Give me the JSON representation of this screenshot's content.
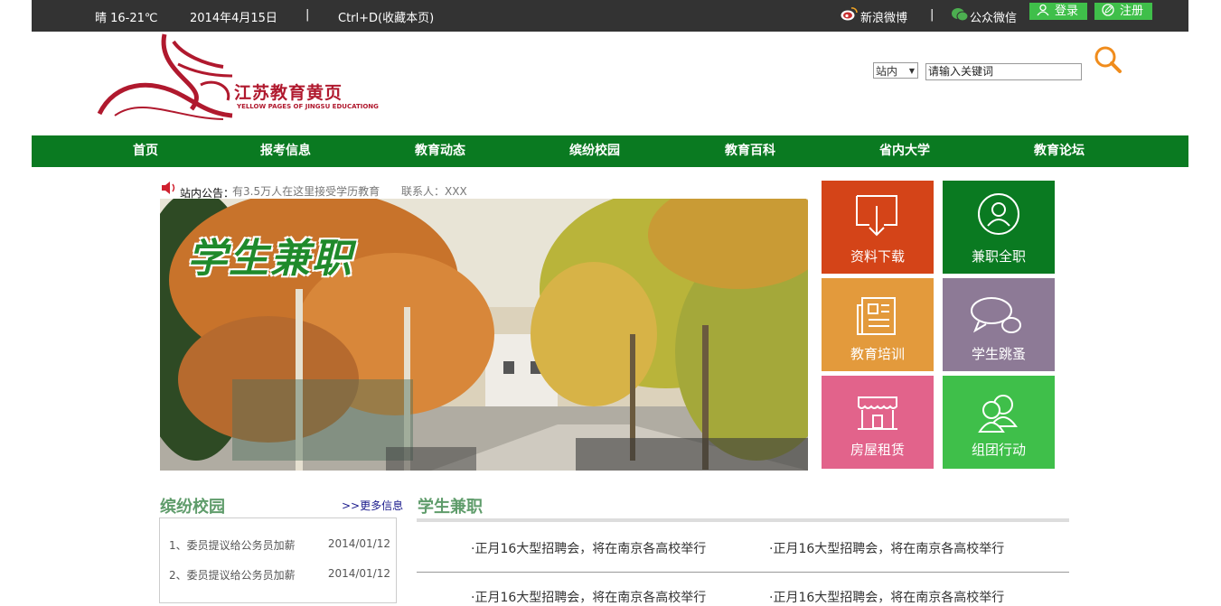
{
  "topbar": {
    "weather": "晴 16-21℃",
    "date": "2014年4月15日",
    "divider": "|",
    "bookmark": "Ctrl+D(收藏本页)",
    "weibo": "新浪微博",
    "divider2": "|",
    "wechat": "公众微信",
    "login": "登录",
    "register": "注册"
  },
  "logo": {
    "name": "江苏教育黄页",
    "subtitle": "YELLOW PAGES OF JINGSU EDUCATIONG"
  },
  "search": {
    "scope": "站内",
    "placeholder": "请输入关键词"
  },
  "nav": [
    "首页",
    "报考信息",
    "教育动态",
    "缤纷校园",
    "教育百科",
    "省内大学",
    "教育论坛"
  ],
  "notice": {
    "label": "站内公告：",
    "text": "有3.5万人在这里接受学历教育",
    "contact": "联系人：XXX"
  },
  "banner": {
    "title": "学生兼职"
  },
  "tiles": [
    {
      "label": "资料下载",
      "icon": "download-icon",
      "color": "#d44418"
    },
    {
      "label": "兼职全职",
      "icon": "user-icon",
      "color": "#0a7a21"
    },
    {
      "label": "教育培训",
      "icon": "newspaper-icon",
      "color": "#e39a3c"
    },
    {
      "label": "学生跳蚤",
      "icon": "chat-icon",
      "color": "#8d7a96"
    },
    {
      "label": "房屋租赁",
      "icon": "shop-icon",
      "color": "#e2638b"
    },
    {
      "label": "组团行动",
      "icon": "group-icon",
      "color": "#3fbf4a"
    }
  ],
  "campus": {
    "title": "缤纷校园",
    "more": ">>更多信息",
    "items": [
      {
        "text": "1、委员提议给公务员加薪",
        "date": "2014/01/12"
      },
      {
        "text": "2、委员提议给公务员加薪",
        "date": "2014/01/12"
      }
    ]
  },
  "jobs": {
    "title": "学生兼职",
    "items": [
      "·正月16大型招聘会，将在南京各高校举行",
      "·正月16大型招聘会，将在南京各高校举行",
      "·正月16大型招聘会，将在南京各高校举行",
      "·正月16大型招聘会，将在南京各高校举行"
    ]
  }
}
